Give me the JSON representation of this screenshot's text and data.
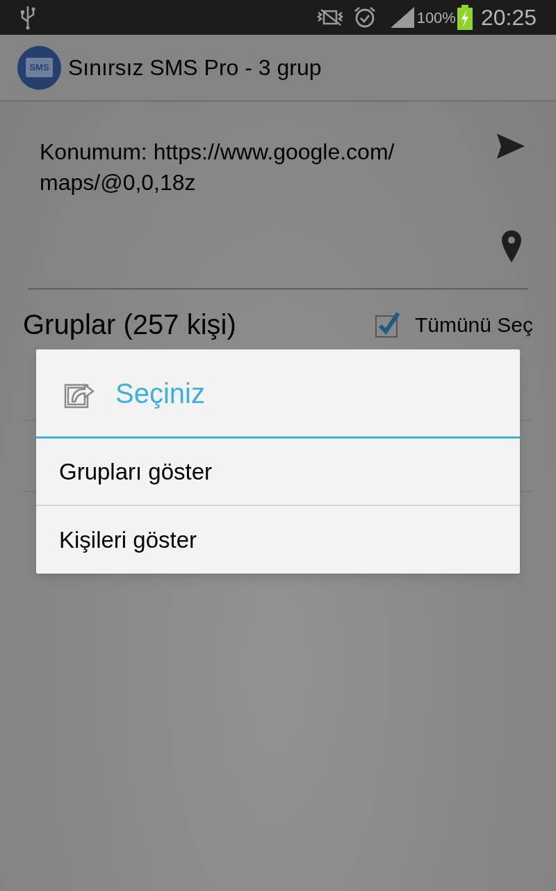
{
  "status_bar": {
    "battery": "100%",
    "time": "20:25"
  },
  "app_bar": {
    "title": "Sınırsız SMS Pro - 3 grup",
    "logo_text": "SMS"
  },
  "message": {
    "value": "Konumum: https://www.google.com/\nmaps/@0,0,18z"
  },
  "groups": {
    "title": "Gruplar (257 kişi)",
    "select_all": {
      "label": "Tümünü Seç",
      "checked": true
    }
  },
  "dialog": {
    "title": "Seçiniz",
    "items": [
      {
        "label": "Grupları göster"
      },
      {
        "label": "Kişileri göster"
      }
    ]
  }
}
